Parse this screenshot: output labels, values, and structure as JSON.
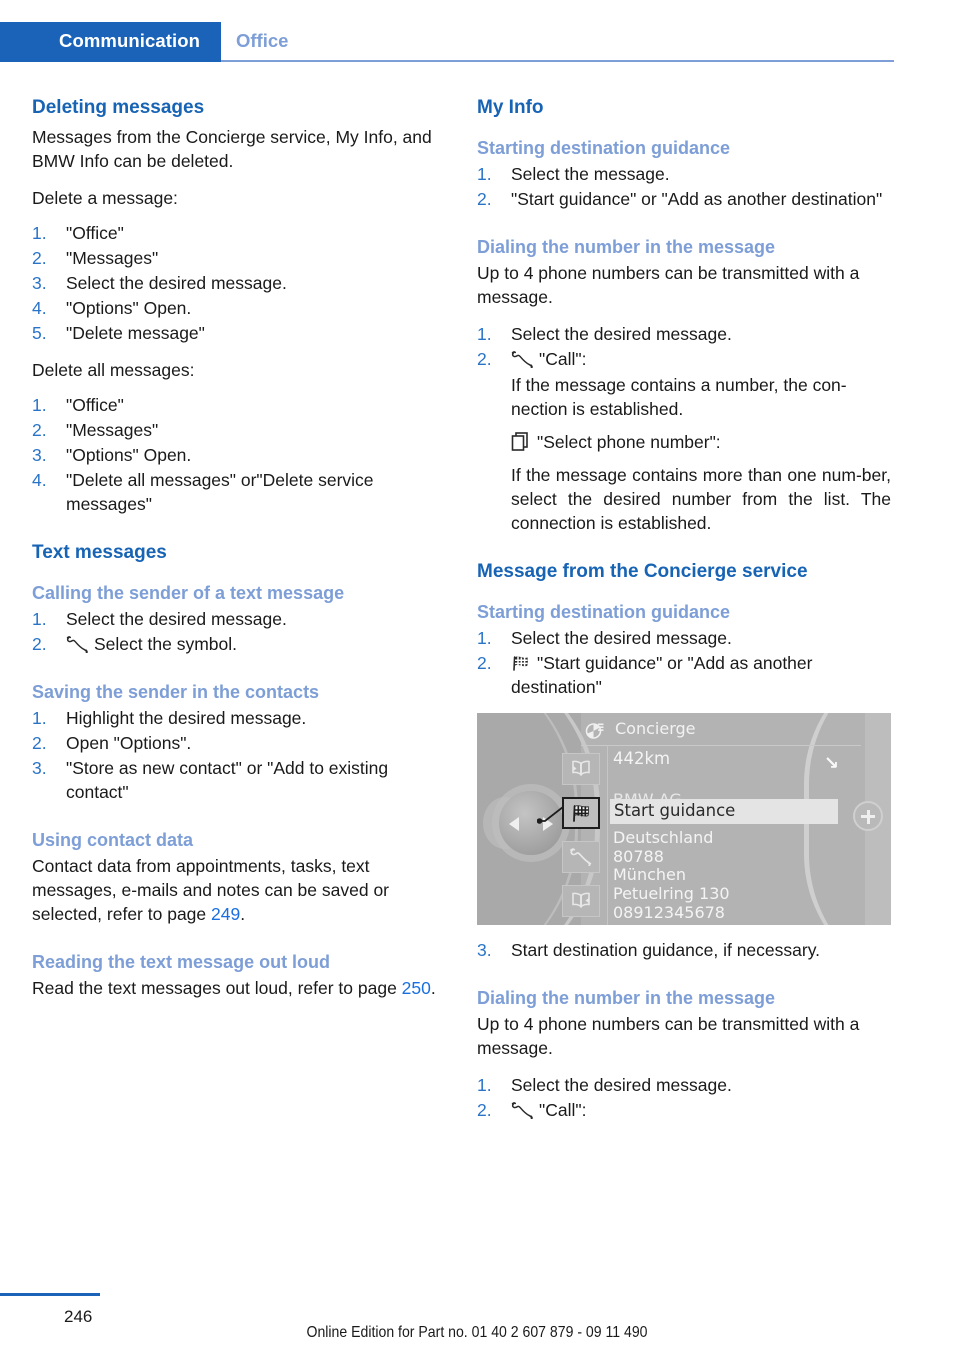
{
  "header": {
    "active_tab": "Communication",
    "inactive_tab": "Office"
  },
  "left_column": {
    "deleting_messages": {
      "heading": "Deleting messages",
      "intro": "Messages from the Concierge service, My Info, and BMW Info can be deleted.",
      "delete_one_label": "Delete a message:",
      "delete_one_steps": [
        "\"Office\"",
        "\"Messages\"",
        "Select the desired message.",
        "\"Options\" Open.",
        "\"Delete message\""
      ],
      "delete_all_label": "Delete all messages:",
      "delete_all_steps": [
        "\"Office\"",
        "\"Messages\"",
        "\"Options\" Open.",
        "\"Delete all messages\" or\"Delete service messages\""
      ]
    },
    "text_messages": {
      "heading": "Text messages",
      "calling_sender": {
        "heading": "Calling the sender of a text message",
        "steps": [
          "Select the desired message.",
          "Select the symbol."
        ],
        "step2_icon": "phone-handset-icon"
      },
      "saving_sender": {
        "heading": "Saving the sender in the contacts",
        "steps": [
          "Highlight the desired message.",
          "Open \"Options\".",
          "\"Store as new contact\" or \"Add to existing contact\""
        ]
      },
      "using_contact_data": {
        "heading": "Using contact data",
        "text_before": "Contact data from appointments, tasks, text messages, e-mails and notes can be saved or selected, refer to page ",
        "page_ref": "249",
        "text_after": "."
      },
      "reading_out_loud": {
        "heading": "Reading the text message out loud",
        "text_before": "Read the text messages out loud, refer to page ",
        "page_ref": "250",
        "text_after": "."
      }
    }
  },
  "right_column": {
    "my_info": {
      "heading": "My Info",
      "starting_guidance": {
        "heading": "Starting destination guidance",
        "steps": [
          "Select the message.",
          "\"Start guidance\" or \"Add as another destination\""
        ]
      },
      "dialing_number": {
        "heading": "Dialing the number in the message",
        "intro": "Up to 4 phone numbers can be transmitted with a message.",
        "step1": "Select the desired message.",
        "step2_icon": "phone-handset-icon",
        "step2": "\"Call\":",
        "step2_detail": "If the message contains a number, the con-nection is established.",
        "select_number_icon": "list-pages-icon",
        "select_number_label": "\"Select phone number\":",
        "select_number_detail": "If the message contains more than one num-ber, select the desired number from the list. The connection is established."
      }
    },
    "concierge": {
      "heading": "Message from the Concierge service",
      "starting_guidance": {
        "heading": "Starting destination guidance",
        "step1": "Select the desired message.",
        "step2_icon": "checkered-flag-icon",
        "step2": "\"Start guidance\" or \"Add as another destination\"",
        "step3": "Start destination guidance, if necessary."
      },
      "dialing_number": {
        "heading": "Dialing the number in the message",
        "intro": "Up to 4 phone numbers can be transmitted with a message.",
        "step1": "Select the desired message.",
        "step2_icon": "phone-handset-icon",
        "step2": "\"Call\":"
      }
    },
    "idrive_screen": {
      "title": "Concierge",
      "title_icon": "concierge-bell-icon",
      "distance": "442km",
      "corner_arrow": "↘",
      "obscured_line": "BMW AG",
      "popup_item": "Start guidance",
      "address_lines": [
        "Deutschland",
        "80788",
        "München",
        "Petuelring 130",
        "08912345678"
      ],
      "side_buttons": [
        {
          "icon": "book-back-icon",
          "selected": false
        },
        {
          "icon": "checkered-flag-icon",
          "selected": true
        },
        {
          "icon": "phone-handset-icon",
          "selected": false
        },
        {
          "icon": "book-forward-icon",
          "selected": false
        }
      ],
      "controller_icon": "controller-left-right-icon",
      "plus_button_icon": "plus-icon"
    }
  },
  "footer": {
    "page_number": "246",
    "edition": "Online Edition for Part no. 01 40 2 607 879 - 09 11 490"
  }
}
